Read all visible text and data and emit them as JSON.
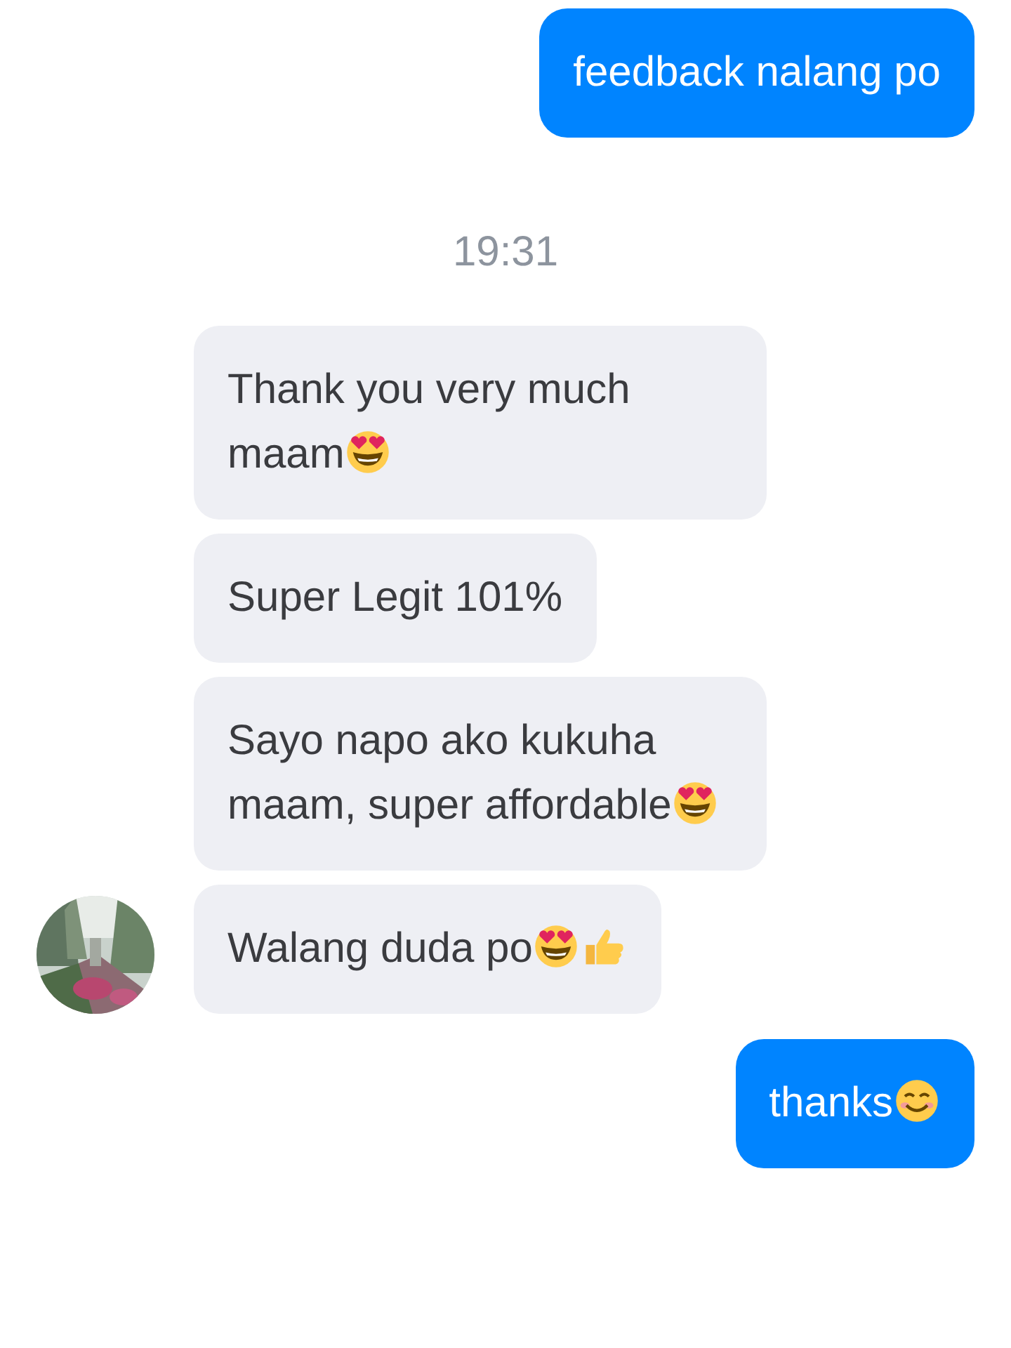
{
  "messages": [
    {
      "kind": "sent",
      "text": "feedback nalang po"
    },
    {
      "kind": "time",
      "text": "19:31"
    },
    {
      "kind": "received",
      "text": "Thank you very much maam",
      "emojis": [
        {
          "kind": "heart-eyes"
        }
      ],
      "avatar": false
    },
    {
      "kind": "received",
      "text": "Super Legit 101%",
      "avatar": false
    },
    {
      "kind": "received",
      "text": "Sayo napo ako kukuha maam, super affordable",
      "emojis": [
        {
          "kind": "heart-eyes"
        }
      ],
      "avatar": false
    },
    {
      "kind": "received",
      "text": "Walang duda po",
      "emojis": [
        {
          "kind": "heart-eyes"
        },
        {
          "kind": "thumbs-up"
        }
      ],
      "avatar": true
    },
    {
      "kind": "sent",
      "text": "thanks",
      "emojis": [
        {
          "kind": "smile"
        }
      ]
    }
  ]
}
